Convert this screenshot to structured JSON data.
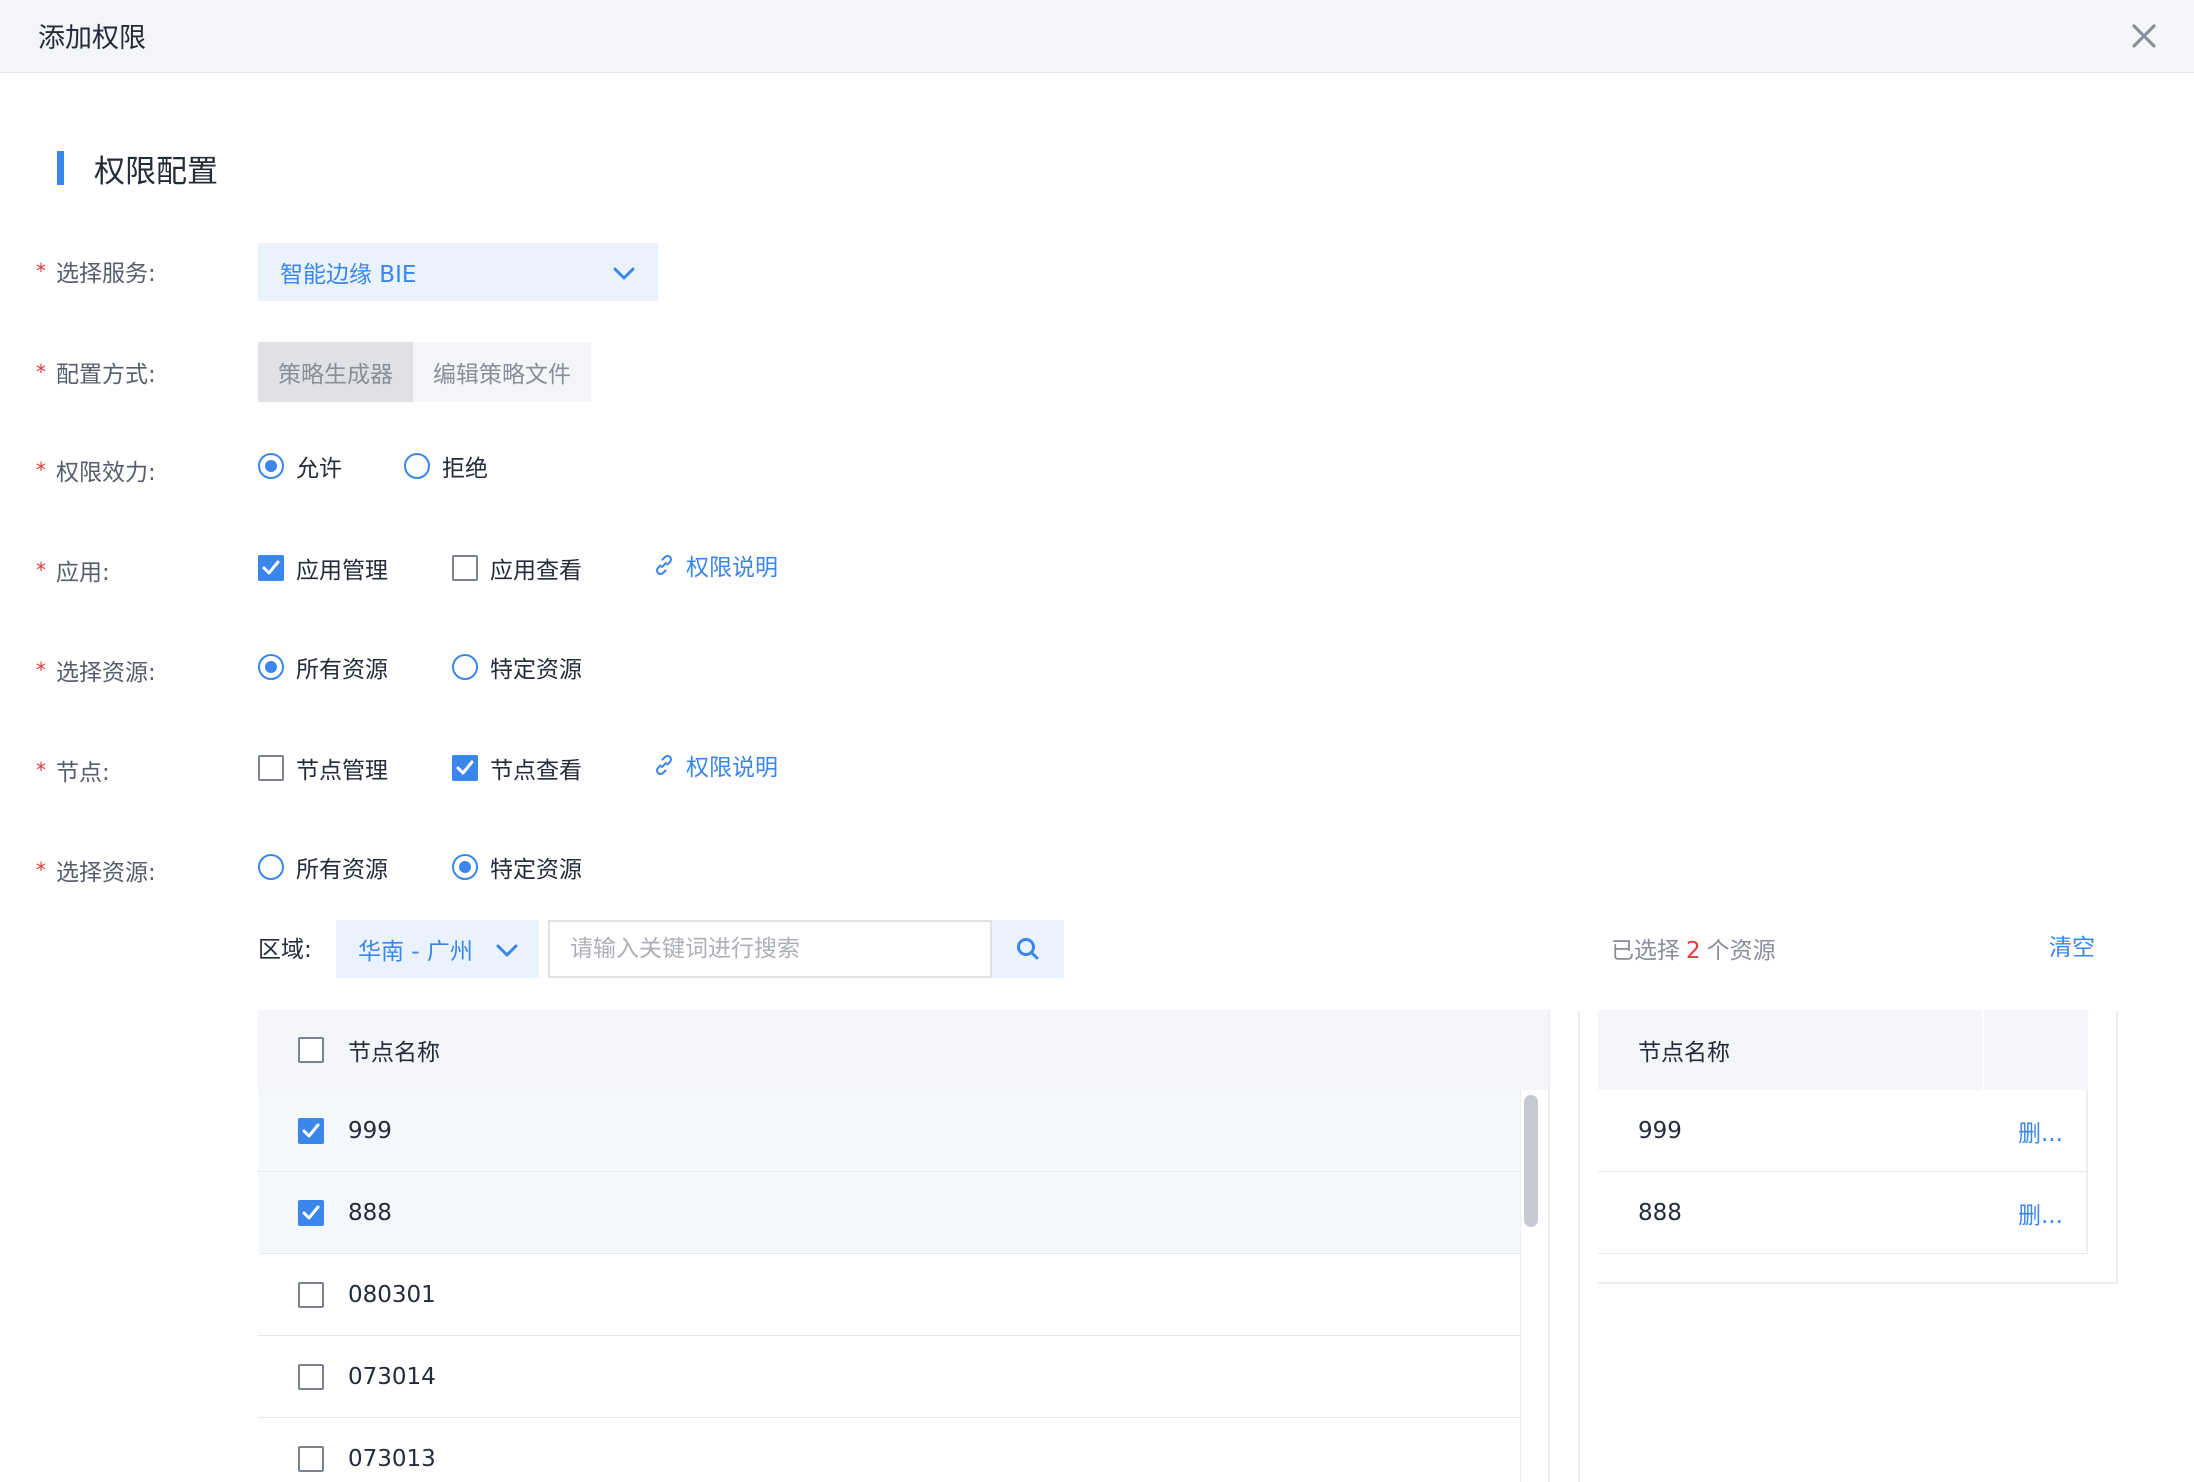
{
  "dialog": {
    "title": "添加权限"
  },
  "section": {
    "title": "权限配置"
  },
  "form": {
    "service": {
      "label": "选择服务:",
      "value": "智能边缘 BIE"
    },
    "config_mode": {
      "label": "配置方式:",
      "options": [
        "策略生成器",
        "编辑策略文件"
      ],
      "selected": "策略生成器"
    },
    "effect": {
      "label": "权限效力:",
      "options": [
        "允许",
        "拒绝"
      ],
      "selected": "允许"
    },
    "app": {
      "label": "应用:",
      "options": [
        "应用管理",
        "应用查看"
      ],
      "checked": [
        "应用管理"
      ],
      "help_link": "权限说明"
    },
    "app_resource": {
      "label": "选择资源:",
      "options": [
        "所有资源",
        "特定资源"
      ],
      "selected": "所有资源"
    },
    "node": {
      "label": "节点:",
      "options": [
        "节点管理",
        "节点查看"
      ],
      "checked": [
        "节点查看"
      ],
      "help_link": "权限说明"
    },
    "node_resource": {
      "label": "选择资源:",
      "options": [
        "所有资源",
        "特定资源"
      ],
      "selected": "特定资源"
    }
  },
  "resource_picker": {
    "region_label": "区域:",
    "region_value": "华南 - 广州",
    "search_placeholder": "请输入关键词进行搜索",
    "selected_prefix": "已选择",
    "selected_count": "2",
    "selected_suffix": "个资源",
    "clear_label": "清空",
    "left_table": {
      "header": "节点名称",
      "rows": [
        {
          "name": "999",
          "checked": true
        },
        {
          "name": "888",
          "checked": true
        },
        {
          "name": "080301",
          "checked": false
        },
        {
          "name": "073014",
          "checked": false
        },
        {
          "name": "073013",
          "checked": false
        }
      ]
    },
    "right_table": {
      "header": "节点名称",
      "rows": [
        {
          "name": "999",
          "action": "删..."
        },
        {
          "name": "888",
          "action": "删..."
        }
      ]
    }
  },
  "colors": {
    "accent": "#3b86ea",
    "required": "#e23a3a",
    "header_bg": "#f3f5f8"
  }
}
